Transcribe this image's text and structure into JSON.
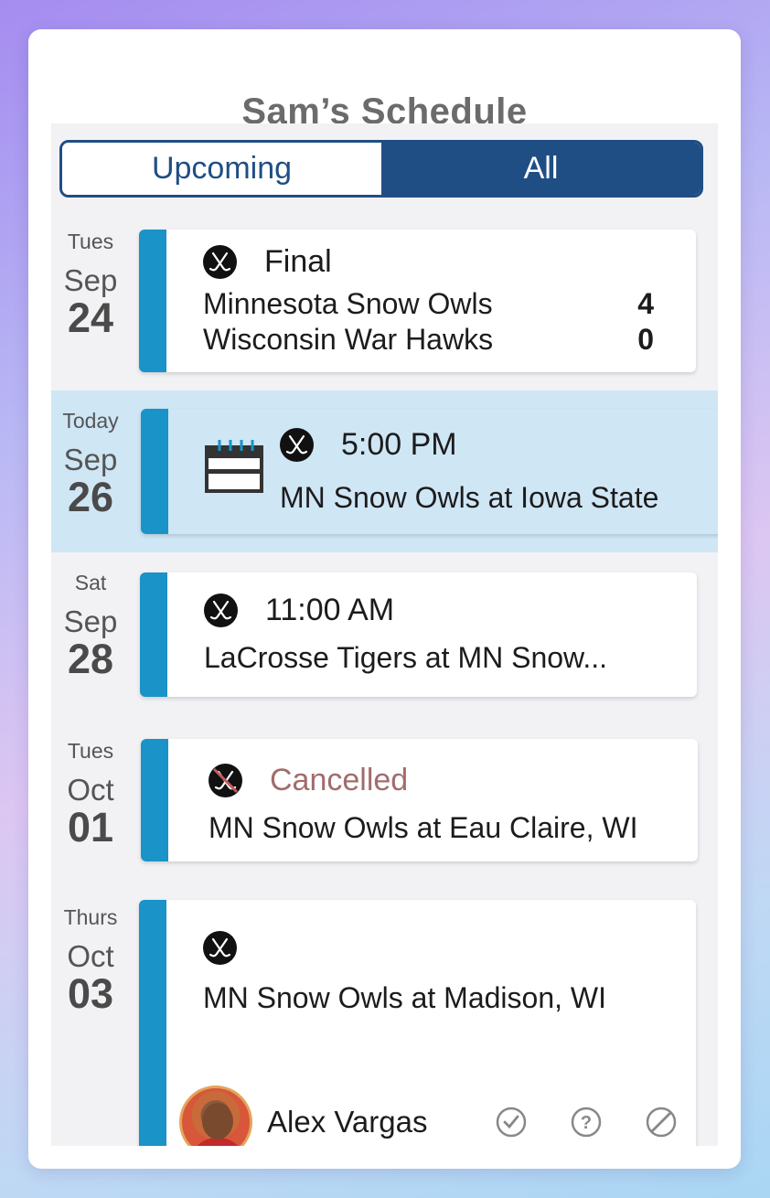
{
  "title": "Sam’s Schedule",
  "segmented": {
    "upcoming": "Upcoming",
    "all": "All",
    "selected": "All"
  },
  "events": [
    {
      "dow": "Tues",
      "month": "Sep",
      "day": "24",
      "status": "Final",
      "home": "Minnesota Snow Owls",
      "home_score": "4",
      "away": "Wisconsin War Hawks",
      "away_score": "0"
    },
    {
      "dow": "Today",
      "month": "Sep",
      "day": "26",
      "time": "5:00 PM",
      "matchup": "MN Snow Owls at Iowa State"
    },
    {
      "dow": "Sat",
      "month": "Sep",
      "day": "28",
      "time": "11:00 AM",
      "matchup": "LaCrosse Tigers at MN Snow..."
    },
    {
      "dow": "Tues",
      "month": "Oct",
      "day": "01",
      "status": "Cancelled",
      "matchup": "MN Snow Owls at Eau Claire, WI"
    },
    {
      "dow": "Thurs",
      "month": "Oct",
      "day": "03",
      "matchup": "MN Snow Owls at Madison, WI",
      "attendee": "Alex Vargas"
    }
  ],
  "colors": {
    "accent": "#1f4e84",
    "bar": "#1a93c8",
    "today_bg": "#cfe6f5",
    "cancelled": "#a26c6c"
  },
  "icons": [
    "hockey-sticks-icon",
    "calendar-icon",
    "check-icon",
    "question-icon",
    "decline-icon"
  ]
}
